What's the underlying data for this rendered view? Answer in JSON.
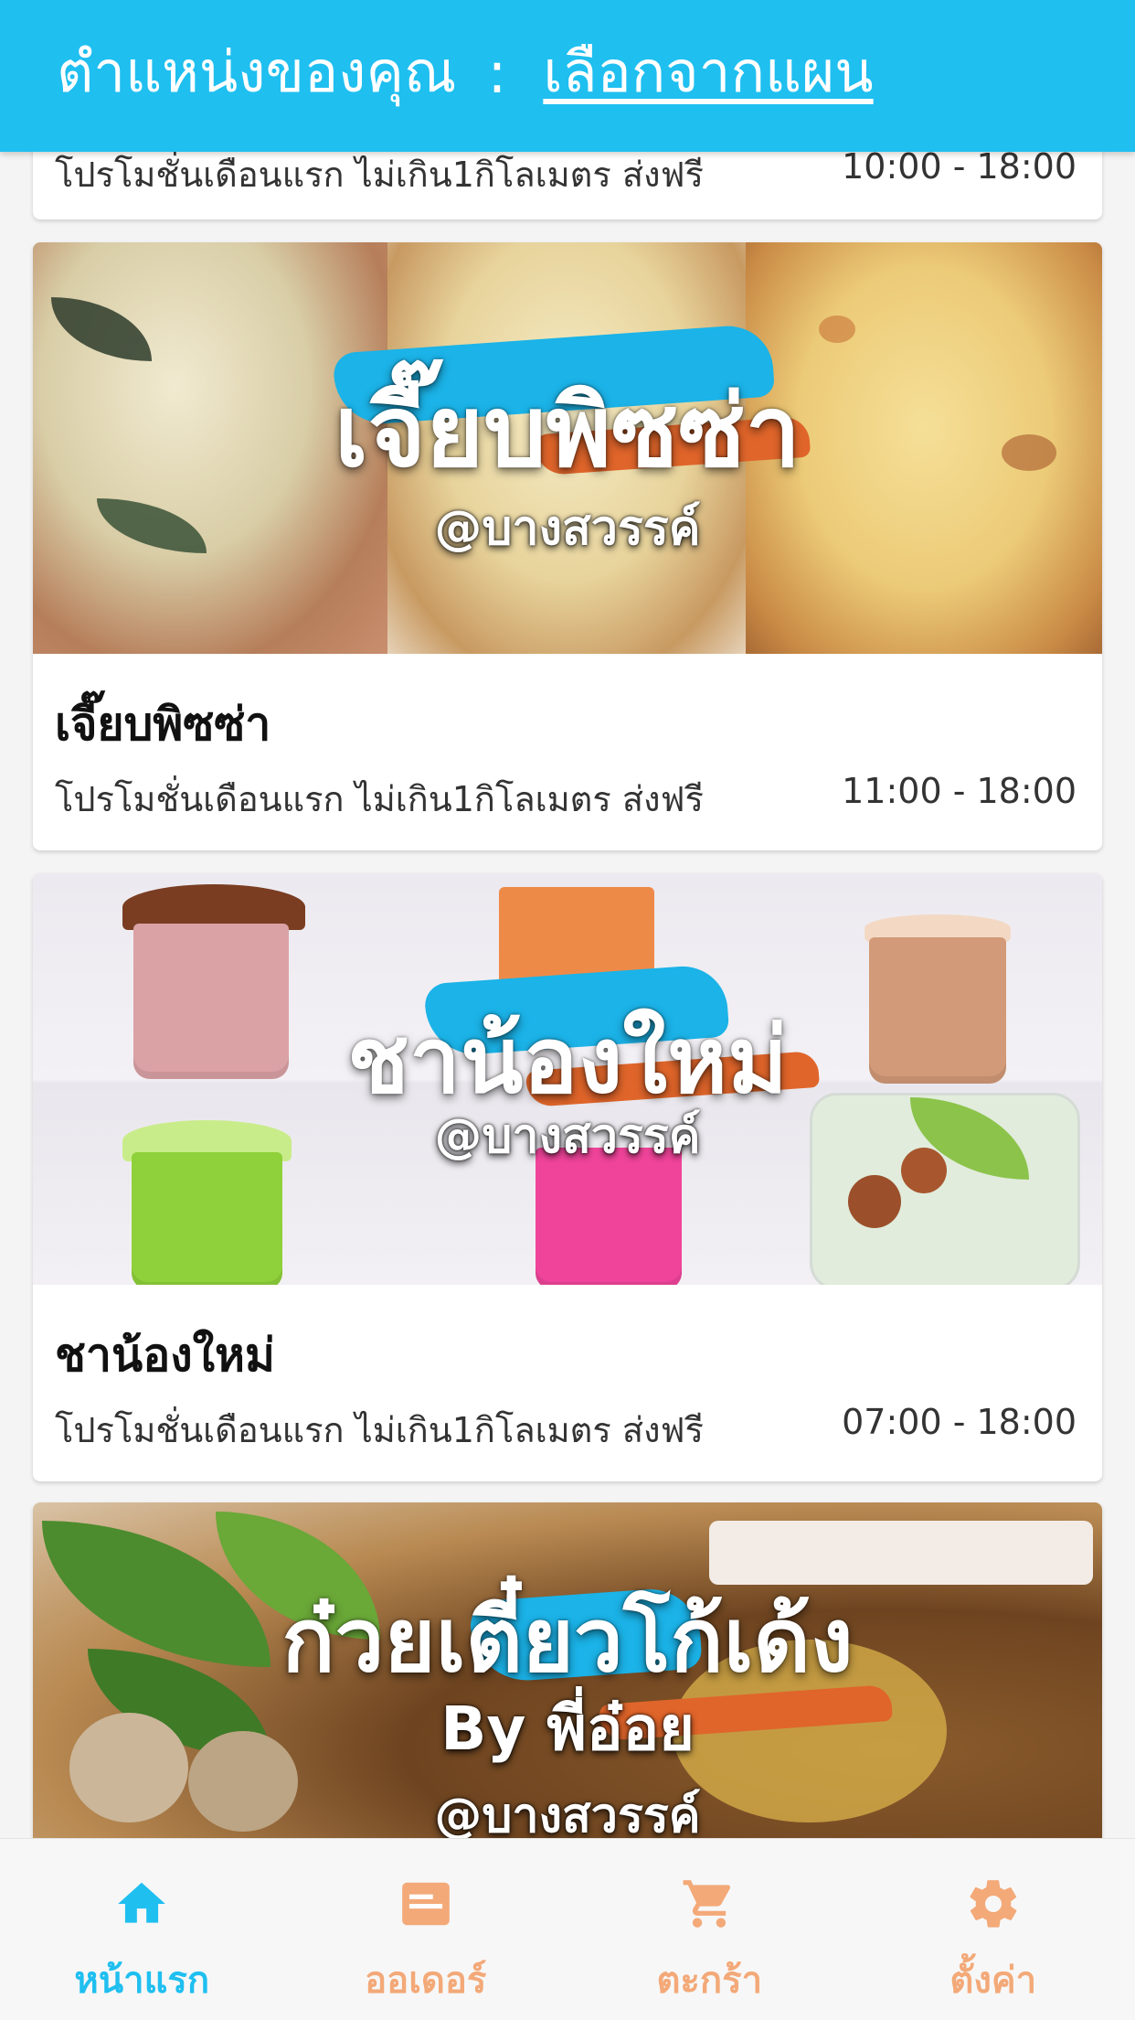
{
  "header": {
    "location_label": "ตำแหน่งของคุณ",
    "separator": ":",
    "choose_from_map": "เลือกจากแผน"
  },
  "stores": [
    {
      "name": "",
      "promo": "โปรโมชั่นเดือนแรก ไม่เกิน1กิโลเมตร ส่งฟรี",
      "hours": "10:00 - 18:00"
    },
    {
      "banner_title": "เจี๊ยบพิซซ่า",
      "banner_sub": "@บางสวรรค์",
      "name": "เจี๊ยบพิซซ่า",
      "promo": "โปรโมชั่นเดือนแรก ไม่เกิน1กิโลเมตร ส่งฟรี",
      "hours": "11:00 - 18:00"
    },
    {
      "banner_title": "ชาน้องใหม่",
      "banner_sub": "@บางสวรรค์",
      "name": "ชาน้องใหม่",
      "promo": "โปรโมชั่นเดือนแรก ไม่เกิน1กิโลเมตร ส่งฟรี",
      "hours": "07:00 - 18:00"
    },
    {
      "banner_title": "ก๋วยเตี๋ยวโก้เด้ง",
      "banner_by": "By พี่อ๋อย",
      "banner_sub": "@บางสวรรค์"
    }
  ],
  "bottom_nav": {
    "home": {
      "label": "หน้าแรก",
      "icon": "home-icon",
      "active": true
    },
    "orders": {
      "label": "ออเดอร์",
      "icon": "order-card-icon"
    },
    "cart": {
      "label": "ตะกร้า",
      "icon": "cart-icon"
    },
    "settings": {
      "label": "ตั้งค่า",
      "icon": "gear-icon"
    }
  },
  "colors": {
    "primary": "#1fbff0",
    "nav_inactive": "#f3a978",
    "splash_blue": "#1bb3e8",
    "splash_orange": "#e0652a"
  }
}
